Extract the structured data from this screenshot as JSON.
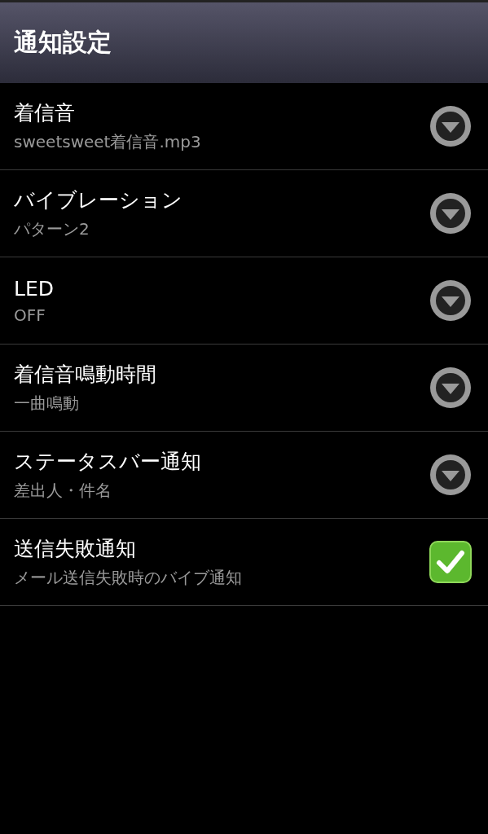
{
  "header": {
    "title": "通知設定"
  },
  "settings": [
    {
      "kind": "dropdown",
      "title": "着信音",
      "summary": "sweetsweet着信音.mp3"
    },
    {
      "kind": "dropdown",
      "title": "バイブレーション",
      "summary": "パターン2"
    },
    {
      "kind": "dropdown",
      "title": "LED",
      "summary": "OFF"
    },
    {
      "kind": "dropdown",
      "title": "着信音鳴動時間",
      "summary": "一曲鳴動"
    },
    {
      "kind": "dropdown",
      "title": "ステータスバー通知",
      "summary": "差出人・件名"
    },
    {
      "kind": "checkbox",
      "title": "送信失敗通知",
      "summary": "メール送信失敗時のバイブ通知",
      "checked": true
    }
  ]
}
